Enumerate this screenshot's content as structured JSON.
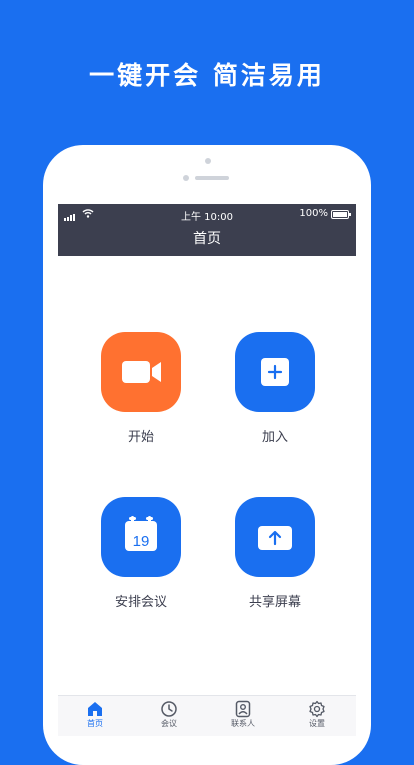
{
  "headline": "一键开会 简洁易用",
  "status_bar": {
    "time": "上午 10:00",
    "battery": "100%"
  },
  "nav": {
    "title": "首页"
  },
  "actions": [
    {
      "label": "开始",
      "icon": "video-camera-icon",
      "color": "#ff7130"
    },
    {
      "label": "加入",
      "icon": "plus-icon",
      "color": "#1a6ff0"
    },
    {
      "label": "安排会议",
      "icon": "calendar-icon",
      "calendar_day": "19",
      "color": "#1a6ff0"
    },
    {
      "label": "共享屏幕",
      "icon": "share-screen-icon",
      "color": "#1a6ff0"
    }
  ],
  "tabs": [
    {
      "label": "首页",
      "icon": "home-icon",
      "active": true
    },
    {
      "label": "会议",
      "icon": "clock-icon",
      "active": false
    },
    {
      "label": "联系人",
      "icon": "contacts-icon",
      "active": false
    },
    {
      "label": "设置",
      "icon": "gear-icon",
      "active": false
    }
  ],
  "colors": {
    "background": "#1a6ff0",
    "header": "#3c3f4f",
    "accent_orange": "#ff7130"
  }
}
